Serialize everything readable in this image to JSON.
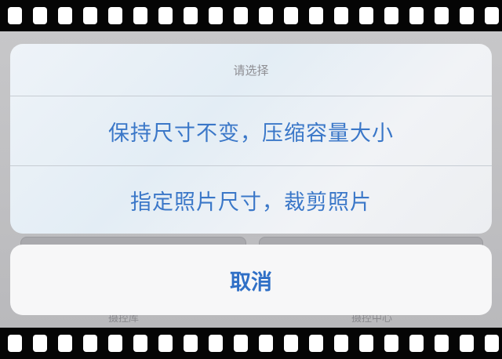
{
  "sheet": {
    "title": "请选择",
    "actions": [
      {
        "label": "保持尺寸不变，压缩容量大小"
      },
      {
        "label": "指定照片尺寸，裁剪照片"
      }
    ],
    "cancel_label": "取消"
  },
  "background": {
    "tabs": [
      {
        "label": "摄控库"
      },
      {
        "label": "摄控中心"
      }
    ]
  },
  "colors": {
    "action_text": "#3a77c8",
    "cancel_text": "#2f6fc6",
    "title_text": "#8e8e93",
    "film_border": "#050505"
  }
}
